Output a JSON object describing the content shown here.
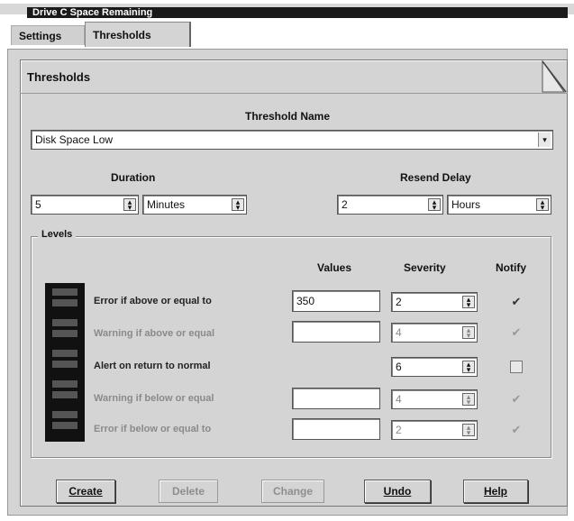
{
  "window": {
    "title": "Drive C Space Remaining"
  },
  "tabs": [
    {
      "label": "Settings",
      "active": false
    },
    {
      "label": "Thresholds",
      "active": true
    }
  ],
  "panel": {
    "title": "Thresholds"
  },
  "threshold_name": {
    "label": "Threshold Name",
    "value": "Disk Space Low"
  },
  "duration": {
    "label": "Duration",
    "value": "5",
    "unit": "Minutes"
  },
  "resend_delay": {
    "label": "Resend Delay",
    "value": "2",
    "unit": "Hours"
  },
  "levels": {
    "group_label": "Levels",
    "columns": {
      "values": "Values",
      "severity": "Severity",
      "notify": "Notify"
    },
    "rows": [
      {
        "label": "Error if above or equal to",
        "value": "350",
        "severity": "2",
        "notify": true,
        "enabled": true
      },
      {
        "label": "Warning if above or equal",
        "value": "",
        "severity": "4",
        "notify": true,
        "enabled": false
      },
      {
        "label": "Alert on return to normal",
        "value": "",
        "severity": "6",
        "notify": false,
        "enabled": true
      },
      {
        "label": "Warning if below or equal",
        "value": "",
        "severity": "4",
        "notify": true,
        "enabled": false
      },
      {
        "label": "Error if below or equal to",
        "value": "",
        "severity": "2",
        "notify": true,
        "enabled": false
      }
    ]
  },
  "buttons": {
    "create": "Create",
    "delete": "Delete",
    "change": "Change",
    "undo": "Undo",
    "help": "Help"
  },
  "icons": {
    "dropdown": "chevron-down-icon",
    "spin": "spin-arrows-icon",
    "check": "checkmark-icon",
    "fold": "page-fold-icon"
  }
}
